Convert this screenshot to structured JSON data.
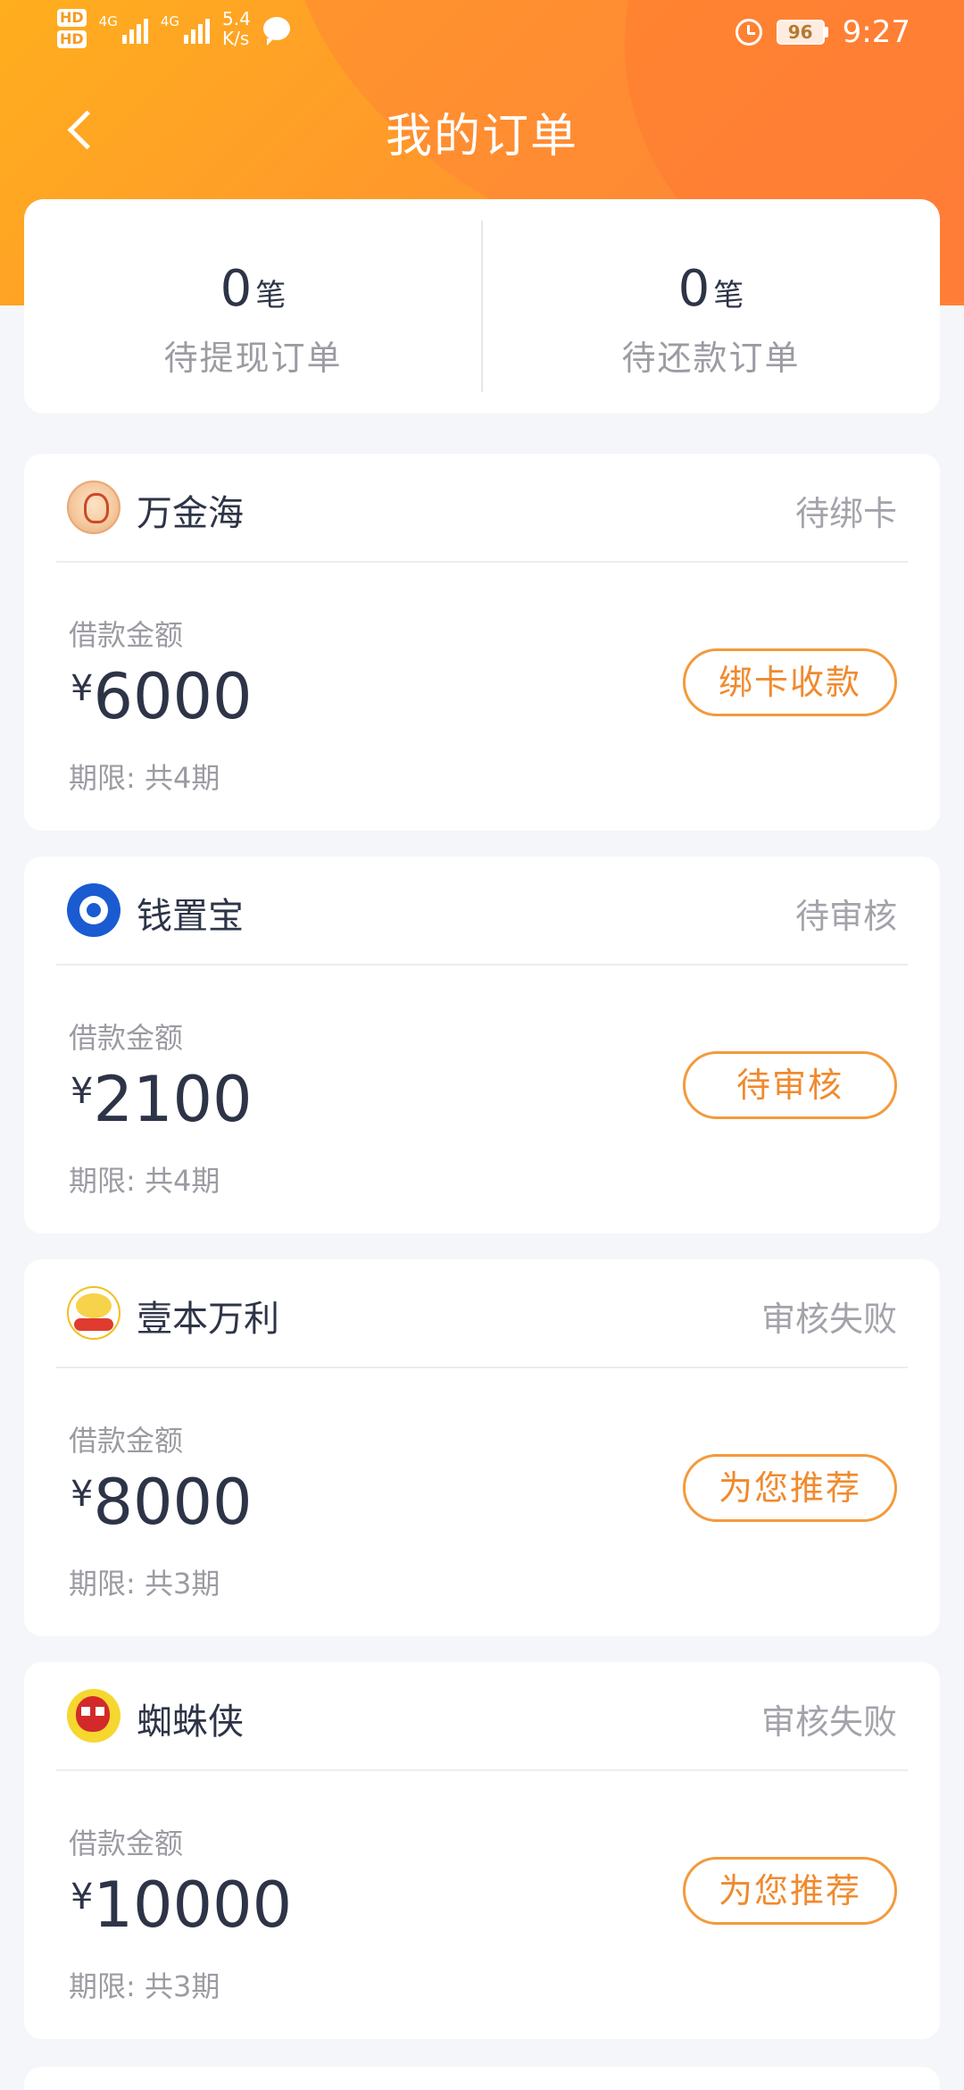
{
  "status_bar": {
    "hd1": "HD",
    "hd2": "HD",
    "net1": "4G",
    "net2": "4G",
    "speed_value": "5.4",
    "speed_unit": "K/s",
    "battery": "96",
    "time": "9:27"
  },
  "nav": {
    "title": "我的订单"
  },
  "summary": {
    "withdraw_count": "0",
    "withdraw_unit": "笔",
    "withdraw_label": "待提现订单",
    "repay_count": "0",
    "repay_unit": "笔",
    "repay_label": "待还款订单"
  },
  "orders": [
    {
      "name": "万金海",
      "status": "待绑卡",
      "amount_label": "借款金额",
      "currency": "¥",
      "amount": "6000",
      "term": "期限: 共4期",
      "action": "绑卡收款"
    },
    {
      "name": "钱置宝",
      "status": "待审核",
      "amount_label": "借款金额",
      "currency": "¥",
      "amount": "2100",
      "term": "期限: 共4期",
      "action": "待审核"
    },
    {
      "name": "壹本万利",
      "status": "审核失败",
      "amount_label": "借款金额",
      "currency": "¥",
      "amount": "8000",
      "term": "期限: 共3期",
      "action": "为您推荐"
    },
    {
      "name": "蜘蛛侠",
      "status": "审核失败",
      "amount_label": "借款金额",
      "currency": "¥",
      "amount": "10000",
      "term": "期限: 共3期",
      "action": "为您推荐"
    }
  ],
  "colors": {
    "accent": "#ff9a2a",
    "button_border": "#f39a3d",
    "text_primary": "#2e3447",
    "text_secondary": "#9b9ba3"
  }
}
